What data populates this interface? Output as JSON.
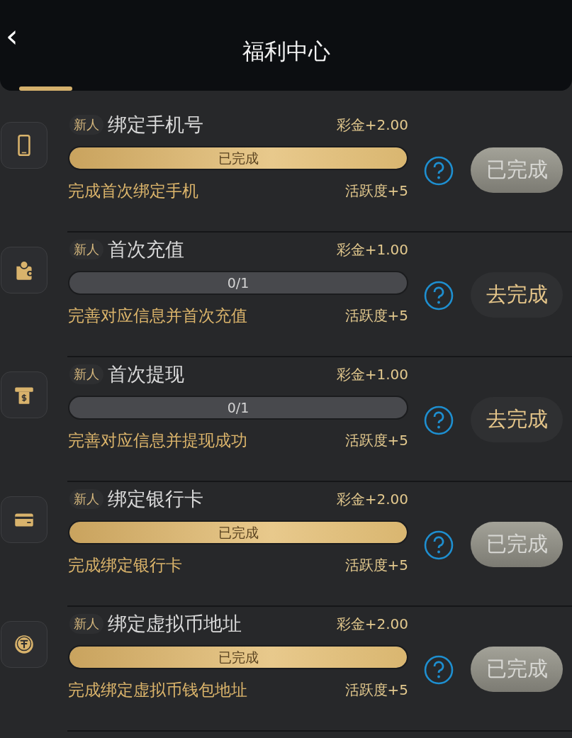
{
  "header": {
    "title": "福利中心",
    "back": "‹"
  },
  "tasks": [
    {
      "kind": "phone",
      "tag": "新人",
      "title": "绑定手机号",
      "reward": "彩金+2.00",
      "level": 1,
      "progress": "已完成",
      "description": "完成首次绑定手机",
      "activity": "活跃度+5",
      "button": "已完成",
      "done": true
    },
    {
      "kind": "wallet",
      "tag": "新人",
      "title": "首次充值",
      "reward": "彩金+1.00",
      "level": 0,
      "progress": "0/1",
      "description": "完善对应信息并首次充值",
      "activity": "活跃度+5",
      "button": "去完成",
      "done": false
    },
    {
      "kind": "atm",
      "tag": "新人",
      "title": "首次提现",
      "reward": "彩金+1.00",
      "level": 0,
      "progress": "0/1",
      "description": "完善对应信息并提现成功",
      "activity": "活跃度+5",
      "button": "去完成",
      "done": false
    },
    {
      "kind": "card",
      "tag": "新人",
      "title": "绑定银行卡",
      "reward": "彩金+2.00",
      "level": 1,
      "progress": "已完成",
      "description": "完成绑定银行卡",
      "activity": "活跃度+5",
      "button": "已完成",
      "done": true
    },
    {
      "kind": "coin",
      "tag": "新人",
      "title": "绑定虚拟币地址",
      "reward": "彩金+2.00",
      "level": 1,
      "progress": "已完成",
      "description": "完成绑定虚拟币钱包地址",
      "activity": "活跃度+5",
      "button": "已完成",
      "done": true
    }
  ]
}
